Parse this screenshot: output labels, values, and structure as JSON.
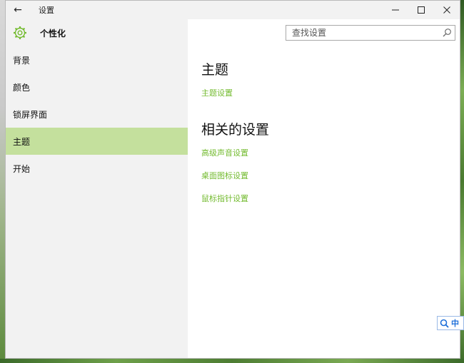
{
  "window": {
    "title": "设置",
    "back_icon": "←",
    "minimize_icon": "—",
    "maximize_icon": "☐",
    "close_icon": "✕"
  },
  "sidebar": {
    "header": "个性化",
    "items": [
      {
        "label": "背景"
      },
      {
        "label": "颜色"
      },
      {
        "label": "锁屏界面"
      },
      {
        "label": "主题"
      },
      {
        "label": "开始"
      }
    ],
    "active_index": 3
  },
  "search": {
    "placeholder": "查找设置"
  },
  "main": {
    "section1_title": "主题",
    "section1_links": [
      "主题设置"
    ],
    "section2_title": "相关的设置",
    "section2_links": [
      "高级声音设置",
      "桌面图标设置",
      "鼠标指针设置"
    ]
  },
  "ime": {
    "label": "中"
  },
  "colors": {
    "accent": "#74bb30",
    "active_bg": "#c4e09d",
    "sidebar_bg": "#f2f2f2"
  }
}
